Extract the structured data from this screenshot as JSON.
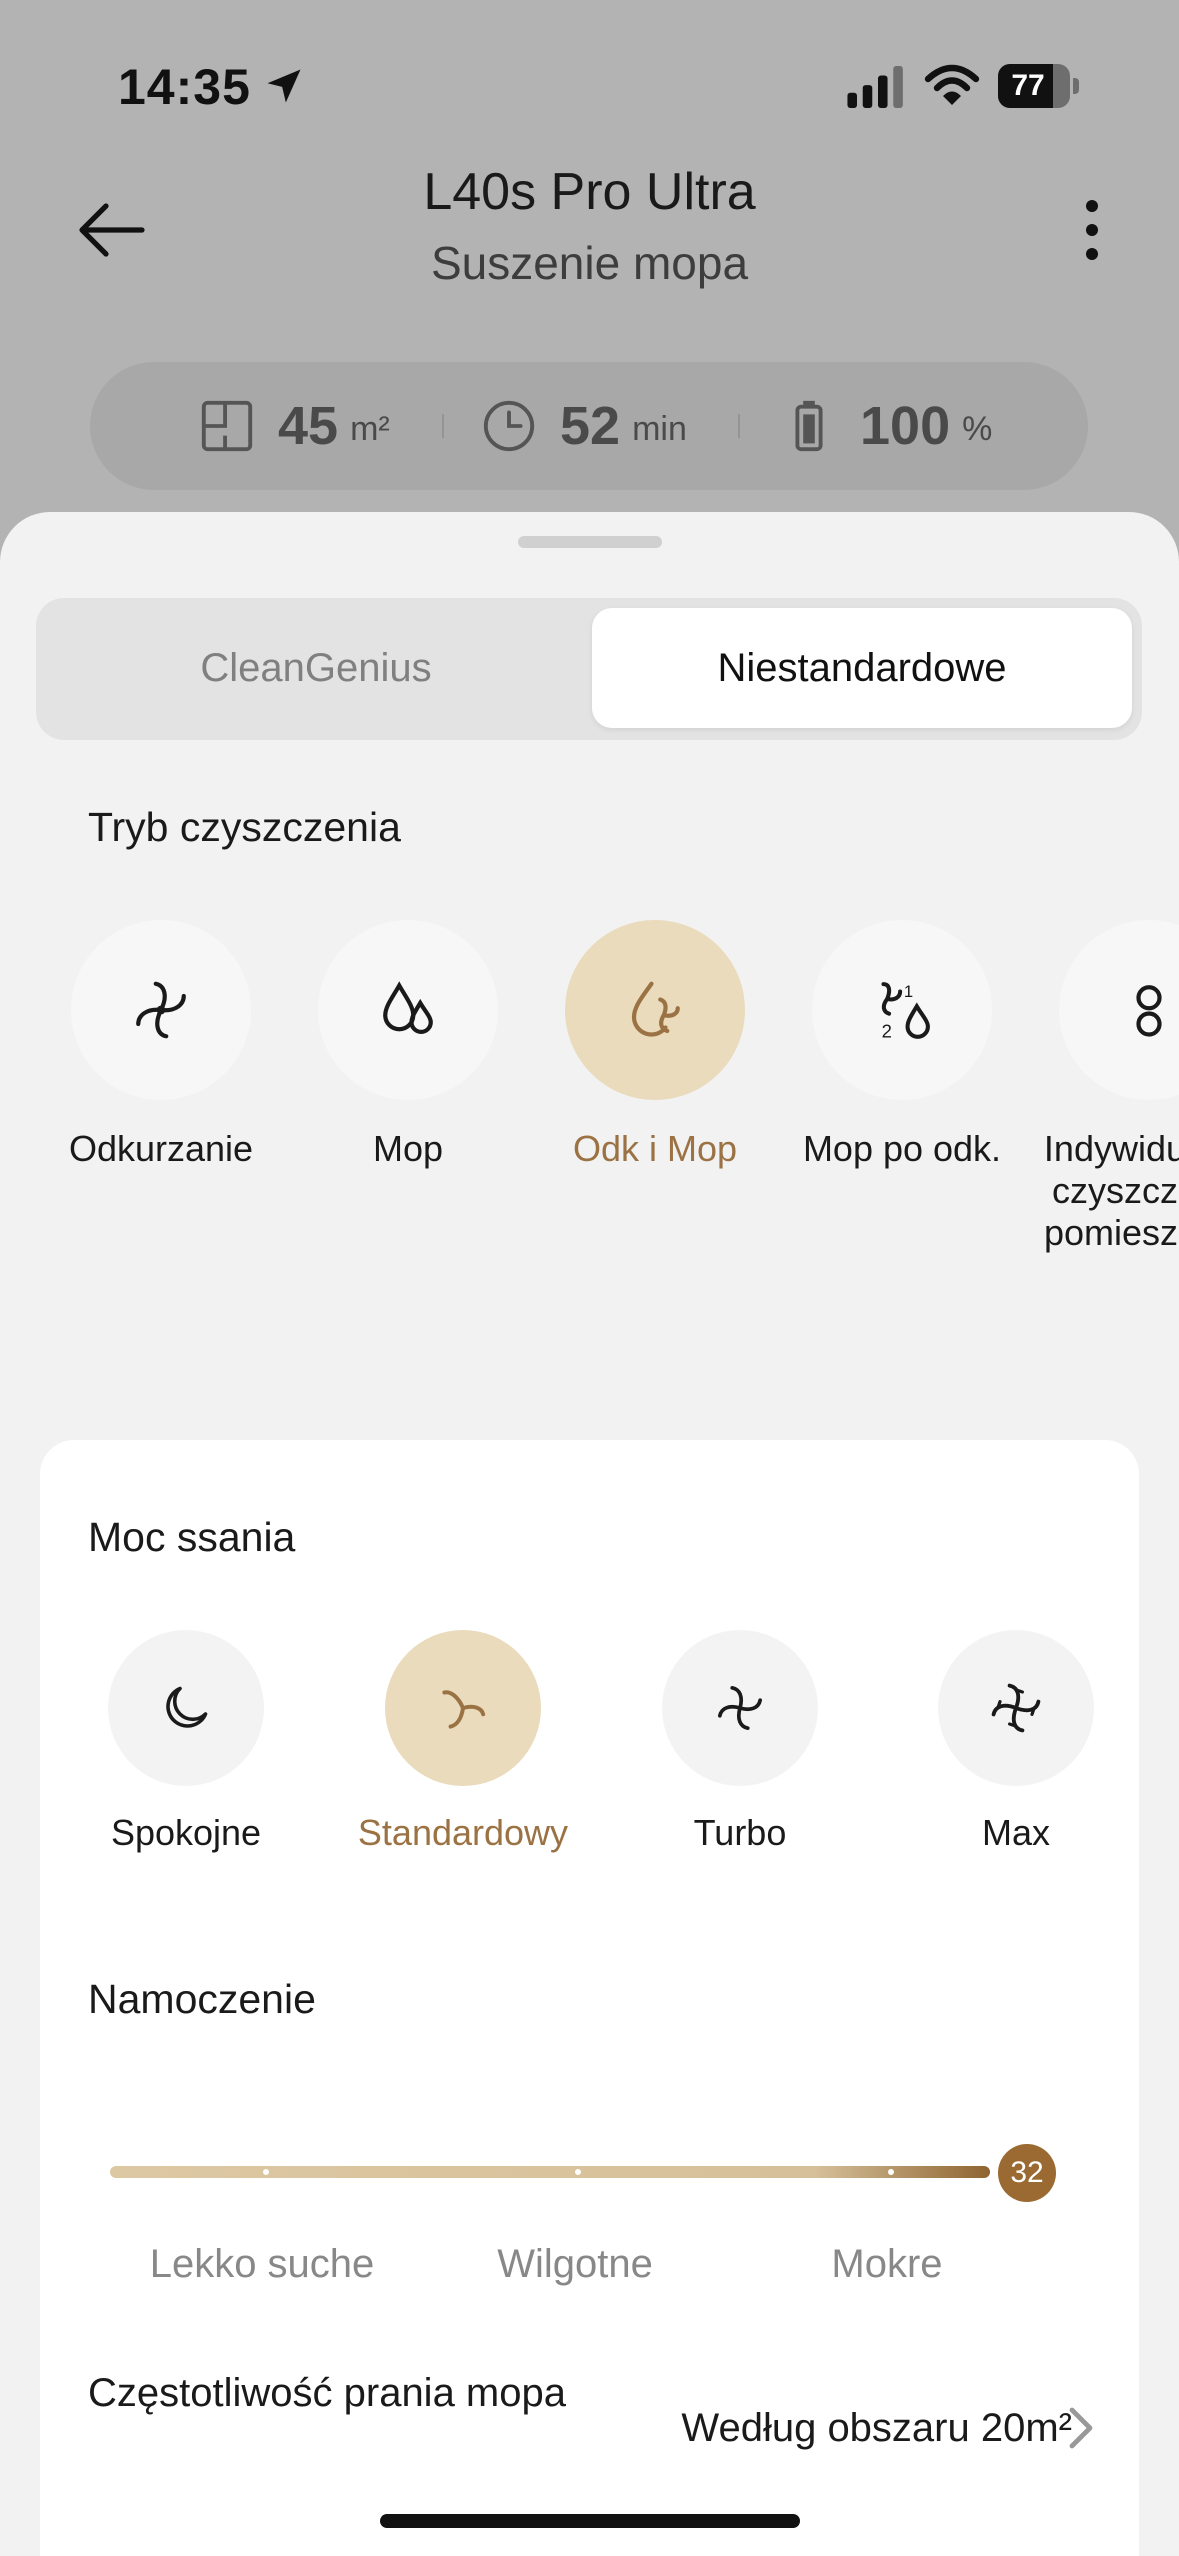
{
  "status_bar": {
    "time": "14:35",
    "battery_text": "77",
    "battery_level": 0.77
  },
  "header": {
    "title": "L40s Pro Ultra",
    "subtitle": "Suszenie mopa"
  },
  "stats": [
    {
      "value": "45",
      "unit": "m²",
      "icon": "area-icon"
    },
    {
      "value": "52",
      "unit": "min",
      "icon": "clock-icon"
    },
    {
      "value": "100",
      "unit": "%",
      "icon": "battery-icon"
    }
  ],
  "tabs": {
    "left": "CleanGenius",
    "right": "Niestandardowe",
    "selected": "right"
  },
  "cleaning_mode": {
    "title": "Tryb czyszczenia",
    "items": [
      {
        "label": "Odkurzanie",
        "icon": "vacuum-icon",
        "selected": false
      },
      {
        "label": "Mop",
        "icon": "water-drops-icon",
        "selected": false
      },
      {
        "label": "Odk i Mop",
        "icon": "vacuum-mop-icon",
        "selected": true
      },
      {
        "label": "Mop po odk.",
        "icon": "mop-after-vacuum-icon",
        "selected": false
      },
      {
        "label": "Indywidualne czyszczenie pomieszczeń",
        "icon": "room-custom-icon",
        "selected": false
      }
    ]
  },
  "suction": {
    "title": "Moc ssania",
    "items": [
      {
        "label": "Spokojne",
        "icon": "moon-icon",
        "selected": false
      },
      {
        "label": "Standardowy",
        "icon": "fan-standard-icon",
        "selected": true
      },
      {
        "label": "Turbo",
        "icon": "fan-turbo-icon",
        "selected": false
      },
      {
        "label": "Max",
        "icon": "fan-max-icon",
        "selected": false
      }
    ]
  },
  "wetness": {
    "title": "Namoczenie",
    "value": "32",
    "level": 1.0,
    "labels": [
      "Lekko suche",
      "Wilgotne",
      "Mokre"
    ]
  },
  "mop_wash": {
    "title": "Częstotliwość prania mopa",
    "value": "Według obszaru 20m²"
  },
  "colors": {
    "accent": "#9b7243",
    "accent_bg": "#e9dbbb",
    "sheet_bg": "#f2f2f2"
  }
}
